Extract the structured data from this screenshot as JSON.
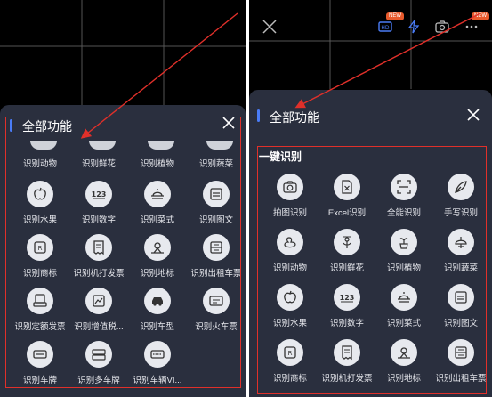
{
  "left_panel": {
    "title": "全部功能",
    "partial_row": [
      "识别动物",
      "识别鲜花",
      "识别植物",
      "识别蔬菜"
    ],
    "rows": [
      [
        {
          "label": "识别水果",
          "icon": "apple-icon"
        },
        {
          "label": "识别数字",
          "icon": "number-123-icon"
        },
        {
          "label": "识别菜式",
          "icon": "dish-icon"
        },
        {
          "label": "识别图文",
          "icon": "image-text-icon"
        }
      ],
      [
        {
          "label": "识别商标",
          "icon": "trademark-icon"
        },
        {
          "label": "识别机打发票",
          "icon": "receipt-icon"
        },
        {
          "label": "识别地标",
          "icon": "landmark-icon"
        },
        {
          "label": "识别出租车票",
          "icon": "taxi-ticket-icon"
        }
      ],
      [
        {
          "label": "识别定额发票",
          "icon": "quota-invoice-icon"
        },
        {
          "label": "识别增值税...",
          "icon": "vat-invoice-icon"
        },
        {
          "label": "识别车型",
          "icon": "car-icon"
        },
        {
          "label": "识别火车票",
          "icon": "train-ticket-icon"
        }
      ],
      [
        {
          "label": "识别车牌",
          "icon": "license-plate-icon"
        },
        {
          "label": "识别多车牌",
          "icon": "multi-plate-icon"
        },
        {
          "label": "识别车辆VI...",
          "icon": "vin-icon"
        }
      ]
    ]
  },
  "right_panel": {
    "title": "全部功能",
    "badges": [
      "NEW",
      "NEW"
    ],
    "section_title": "一键识别",
    "rows": [
      [
        {
          "label": "拍图识别",
          "icon": "camera-icon"
        },
        {
          "label": "Excel识别",
          "icon": "excel-icon"
        },
        {
          "label": "全能识别",
          "icon": "scan-icon"
        },
        {
          "label": "手写识别",
          "icon": "pen-icon"
        }
      ],
      [
        {
          "label": "识别动物",
          "icon": "duck-icon"
        },
        {
          "label": "识别鲜花",
          "icon": "flower-icon"
        },
        {
          "label": "识别植物",
          "icon": "plant-icon"
        },
        {
          "label": "识别蔬菜",
          "icon": "vegetable-icon"
        }
      ],
      [
        {
          "label": "识别水果",
          "icon": "apple-icon"
        },
        {
          "label": "识别数字",
          "icon": "number-123-icon"
        },
        {
          "label": "识别菜式",
          "icon": "dish-icon"
        },
        {
          "label": "识别图文",
          "icon": "image-text-icon"
        }
      ],
      [
        {
          "label": "识别商标",
          "icon": "trademark-icon"
        },
        {
          "label": "识别机打发票",
          "icon": "receipt-icon"
        },
        {
          "label": "识别地标",
          "icon": "landmark-icon"
        },
        {
          "label": "识别出租车票",
          "icon": "taxi-ticket-icon"
        }
      ]
    ]
  },
  "colors": {
    "sheet": "#2a2f3e",
    "accent": "#4a7cf6",
    "highlight": "#e0302a",
    "badge": "#e85a2c"
  }
}
